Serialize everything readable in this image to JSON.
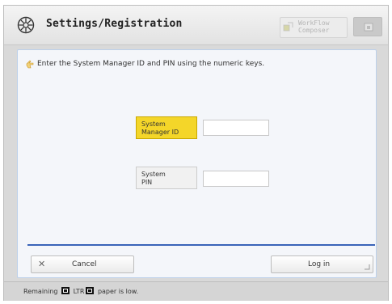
{
  "header": {
    "title": "Settings/Registration",
    "workflow_label": "WorkFlow\nComposer",
    "icons": [
      "gear-icon",
      "workflow-icon",
      "home-icon"
    ]
  },
  "main": {
    "instruction": "Enter the System Manager ID and PIN using the numeric keys.",
    "fields": {
      "manager_id_label": "System\nManager ID",
      "manager_id_value": "",
      "pin_label": "System\nPIN",
      "pin_value": ""
    },
    "cancel_label": "Cancel",
    "login_label": "Log in"
  },
  "status": {
    "prefix": "Remaining",
    "paper_size": "LTR",
    "suffix": "paper is low."
  },
  "colors": {
    "accent_selected": "#f4d629",
    "divider": "#3a64b8",
    "panel_border": "#bcd0ea"
  }
}
